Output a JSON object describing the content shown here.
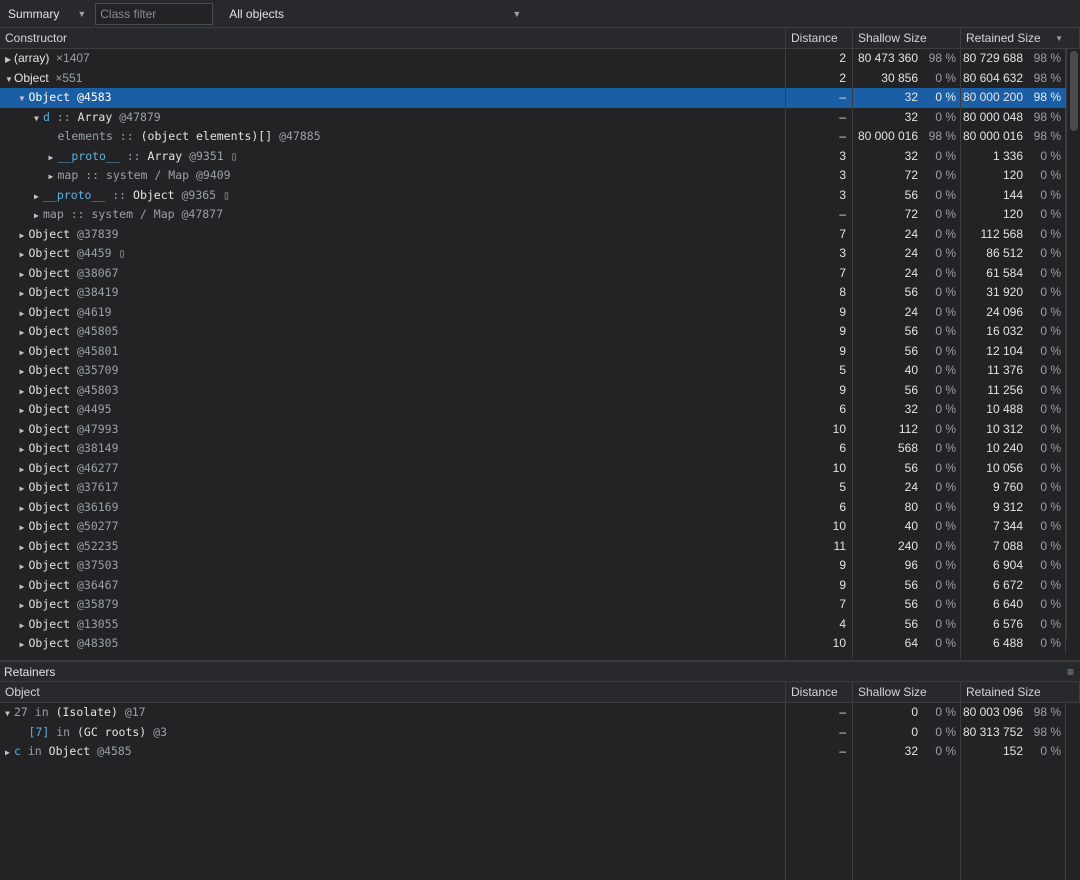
{
  "toolbar": {
    "view": "Summary",
    "filter_placeholder": "Class filter",
    "objects": "All objects"
  },
  "columns": {
    "constructor": "Constructor",
    "object": "Object",
    "distance": "Distance",
    "shallow": "Shallow Size",
    "retained": "Retained Size",
    "sort_icon": "triangle-down"
  },
  "colors": {
    "selected": "#1a5fa5",
    "property": "#5cb2dc",
    "background": "#232325"
  },
  "rows": [
    {
      "level": 0,
      "arrow": "right",
      "sans": true,
      "segs": [
        {
          "t": "(array)",
          "c": "white"
        },
        {
          "t": "  ×1407",
          "c": "gray"
        }
      ],
      "d": "2",
      "s": "80 473 360",
      "sp": "98 %",
      "r": "80 729 688",
      "rp": "98 %"
    },
    {
      "level": 0,
      "arrow": "down",
      "sans": true,
      "segs": [
        {
          "t": "Object",
          "c": "white"
        },
        {
          "t": "  ×551",
          "c": "gray"
        }
      ],
      "d": "2",
      "s": "30 856",
      "sp": "0 %",
      "r": "80 604 632",
      "rp": "98 %"
    },
    {
      "level": 1,
      "arrow": "down",
      "selected": true,
      "segs": [
        {
          "t": "Object ",
          "c": "white"
        },
        {
          "t": "@4583",
          "c": "id"
        }
      ],
      "d": "–",
      "s": "32",
      "sp": "0 %",
      "r": "80 000 200",
      "rp": "98 %"
    },
    {
      "level": 2,
      "arrow": "down",
      "segs": [
        {
          "t": "d",
          "c": "prop"
        },
        {
          "t": " :: ",
          "c": "gray"
        },
        {
          "t": "Array ",
          "c": "white"
        },
        {
          "t": "@47879",
          "c": "id"
        }
      ],
      "d": "–",
      "s": "32",
      "sp": "0 %",
      "r": "80 000 048",
      "rp": "98 %"
    },
    {
      "level": 3,
      "arrow": "",
      "segs": [
        {
          "t": "elements :: ",
          "c": "gray"
        },
        {
          "t": "(object elements)[] ",
          "c": "white"
        },
        {
          "t": "@47885",
          "c": "id"
        }
      ],
      "d": "–",
      "s": "80 000 016",
      "sp": "98 %",
      "r": "80 000 016",
      "rp": "98 %"
    },
    {
      "level": 3,
      "arrow": "right",
      "segs": [
        {
          "t": "__proto__",
          "c": "prop"
        },
        {
          "t": " :: ",
          "c": "gray"
        },
        {
          "t": "Array ",
          "c": "white"
        },
        {
          "t": "@9351 ",
          "c": "id"
        },
        {
          "t": "▯",
          "c": "gray"
        }
      ],
      "d": "3",
      "s": "32",
      "sp": "0 %",
      "r": "1 336",
      "rp": "0 %"
    },
    {
      "level": 3,
      "arrow": "right",
      "segs": [
        {
          "t": "map :: system / Map @9409",
          "c": "gray"
        }
      ],
      "d": "3",
      "s": "72",
      "sp": "0 %",
      "r": "120",
      "rp": "0 %"
    },
    {
      "level": 2,
      "arrow": "right",
      "segs": [
        {
          "t": "__proto__",
          "c": "prop"
        },
        {
          "t": " :: ",
          "c": "gray"
        },
        {
          "t": "Object ",
          "c": "white"
        },
        {
          "t": "@9365 ",
          "c": "id"
        },
        {
          "t": "▯",
          "c": "gray"
        }
      ],
      "d": "3",
      "s": "56",
      "sp": "0 %",
      "r": "144",
      "rp": "0 %"
    },
    {
      "level": 2,
      "arrow": "right",
      "segs": [
        {
          "t": "map :: system / Map @47877",
          "c": "gray"
        }
      ],
      "d": "–",
      "s": "72",
      "sp": "0 %",
      "r": "120",
      "rp": "0 %"
    },
    {
      "level": 1,
      "arrow": "right",
      "segs": [
        {
          "t": "Object ",
          "c": "white"
        },
        {
          "t": "@37839",
          "c": "id"
        }
      ],
      "d": "7",
      "s": "24",
      "sp": "0 %",
      "r": "112 568",
      "rp": "0 %"
    },
    {
      "level": 1,
      "arrow": "right",
      "segs": [
        {
          "t": "Object ",
          "c": "white"
        },
        {
          "t": "@4459 ",
          "c": "id"
        },
        {
          "t": "▯",
          "c": "gray"
        }
      ],
      "d": "3",
      "s": "24",
      "sp": "0 %",
      "r": "86 512",
      "rp": "0 %"
    },
    {
      "level": 1,
      "arrow": "right",
      "segs": [
        {
          "t": "Object ",
          "c": "white"
        },
        {
          "t": "@38067",
          "c": "id"
        }
      ],
      "d": "7",
      "s": "24",
      "sp": "0 %",
      "r": "61 584",
      "rp": "0 %"
    },
    {
      "level": 1,
      "arrow": "right",
      "segs": [
        {
          "t": "Object ",
          "c": "white"
        },
        {
          "t": "@38419",
          "c": "id"
        }
      ],
      "d": "8",
      "s": "56",
      "sp": "0 %",
      "r": "31 920",
      "rp": "0 %"
    },
    {
      "level": 1,
      "arrow": "right",
      "segs": [
        {
          "t": "Object ",
          "c": "white"
        },
        {
          "t": "@4619",
          "c": "id"
        }
      ],
      "d": "9",
      "s": "24",
      "sp": "0 %",
      "r": "24 096",
      "rp": "0 %"
    },
    {
      "level": 1,
      "arrow": "right",
      "segs": [
        {
          "t": "Object ",
          "c": "white"
        },
        {
          "t": "@45805",
          "c": "id"
        }
      ],
      "d": "9",
      "s": "56",
      "sp": "0 %",
      "r": "16 032",
      "rp": "0 %"
    },
    {
      "level": 1,
      "arrow": "right",
      "segs": [
        {
          "t": "Object ",
          "c": "white"
        },
        {
          "t": "@45801",
          "c": "id"
        }
      ],
      "d": "9",
      "s": "56",
      "sp": "0 %",
      "r": "12 104",
      "rp": "0 %"
    },
    {
      "level": 1,
      "arrow": "right",
      "segs": [
        {
          "t": "Object ",
          "c": "white"
        },
        {
          "t": "@35709",
          "c": "id"
        }
      ],
      "d": "5",
      "s": "40",
      "sp": "0 %",
      "r": "11 376",
      "rp": "0 %"
    },
    {
      "level": 1,
      "arrow": "right",
      "segs": [
        {
          "t": "Object ",
          "c": "white"
        },
        {
          "t": "@45803",
          "c": "id"
        }
      ],
      "d": "9",
      "s": "56",
      "sp": "0 %",
      "r": "11 256",
      "rp": "0 %"
    },
    {
      "level": 1,
      "arrow": "right",
      "segs": [
        {
          "t": "Object ",
          "c": "white"
        },
        {
          "t": "@4495",
          "c": "id"
        }
      ],
      "d": "6",
      "s": "32",
      "sp": "0 %",
      "r": "10 488",
      "rp": "0 %"
    },
    {
      "level": 1,
      "arrow": "right",
      "segs": [
        {
          "t": "Object ",
          "c": "white"
        },
        {
          "t": "@47993",
          "c": "id"
        }
      ],
      "d": "10",
      "s": "112",
      "sp": "0 %",
      "r": "10 312",
      "rp": "0 %"
    },
    {
      "level": 1,
      "arrow": "right",
      "segs": [
        {
          "t": "Object ",
          "c": "white"
        },
        {
          "t": "@38149",
          "c": "id"
        }
      ],
      "d": "6",
      "s": "568",
      "sp": "0 %",
      "r": "10 240",
      "rp": "0 %"
    },
    {
      "level": 1,
      "arrow": "right",
      "segs": [
        {
          "t": "Object ",
          "c": "white"
        },
        {
          "t": "@46277",
          "c": "id"
        }
      ],
      "d": "10",
      "s": "56",
      "sp": "0 %",
      "r": "10 056",
      "rp": "0 %"
    },
    {
      "level": 1,
      "arrow": "right",
      "segs": [
        {
          "t": "Object ",
          "c": "white"
        },
        {
          "t": "@37617",
          "c": "id"
        }
      ],
      "d": "5",
      "s": "24",
      "sp": "0 %",
      "r": "9 760",
      "rp": "0 %"
    },
    {
      "level": 1,
      "arrow": "right",
      "segs": [
        {
          "t": "Object ",
          "c": "white"
        },
        {
          "t": "@36169",
          "c": "id"
        }
      ],
      "d": "6",
      "s": "80",
      "sp": "0 %",
      "r": "9 312",
      "rp": "0 %"
    },
    {
      "level": 1,
      "arrow": "right",
      "segs": [
        {
          "t": "Object ",
          "c": "white"
        },
        {
          "t": "@50277",
          "c": "id"
        }
      ],
      "d": "10",
      "s": "40",
      "sp": "0 %",
      "r": "7 344",
      "rp": "0 %"
    },
    {
      "level": 1,
      "arrow": "right",
      "segs": [
        {
          "t": "Object ",
          "c": "white"
        },
        {
          "t": "@52235",
          "c": "id"
        }
      ],
      "d": "11",
      "s": "240",
      "sp": "0 %",
      "r": "7 088",
      "rp": "0 %"
    },
    {
      "level": 1,
      "arrow": "right",
      "segs": [
        {
          "t": "Object ",
          "c": "white"
        },
        {
          "t": "@37503",
          "c": "id"
        }
      ],
      "d": "9",
      "s": "96",
      "sp": "0 %",
      "r": "6 904",
      "rp": "0 %"
    },
    {
      "level": 1,
      "arrow": "right",
      "segs": [
        {
          "t": "Object ",
          "c": "white"
        },
        {
          "t": "@36467",
          "c": "id"
        }
      ],
      "d": "9",
      "s": "56",
      "sp": "0 %",
      "r": "6 672",
      "rp": "0 %"
    },
    {
      "level": 1,
      "arrow": "right",
      "segs": [
        {
          "t": "Object ",
          "c": "white"
        },
        {
          "t": "@35879",
          "c": "id"
        }
      ],
      "d": "7",
      "s": "56",
      "sp": "0 %",
      "r": "6 640",
      "rp": "0 %"
    },
    {
      "level": 1,
      "arrow": "right",
      "segs": [
        {
          "t": "Object ",
          "c": "white"
        },
        {
          "t": "@13055",
          "c": "id"
        }
      ],
      "d": "4",
      "s": "56",
      "sp": "0 %",
      "r": "6 576",
      "rp": "0 %"
    },
    {
      "level": 1,
      "arrow": "right",
      "segs": [
        {
          "t": "Object ",
          "c": "white"
        },
        {
          "t": "@48305",
          "c": "id"
        }
      ],
      "d": "10",
      "s": "64",
      "sp": "0 %",
      "r": "6 488",
      "rp": "0 %"
    }
  ],
  "retainers": {
    "title": "Retainers",
    "rows": [
      {
        "level": 0,
        "arrow": "down",
        "segs": [
          {
            "t": "27",
            "c": "gray"
          },
          {
            "t": " in ",
            "c": "gray"
          },
          {
            "t": "(Isolate) ",
            "c": "white"
          },
          {
            "t": "@17",
            "c": "id"
          }
        ],
        "d": "–",
        "s": "0",
        "sp": "0 %",
        "r": "80 003 096",
        "rp": "98 %"
      },
      {
        "level": 1,
        "arrow": "",
        "segs": [
          {
            "t": "[7]",
            "c": "prop"
          },
          {
            "t": " in ",
            "c": "gray"
          },
          {
            "t": "(GC roots) ",
            "c": "white"
          },
          {
            "t": "@3",
            "c": "id"
          }
        ],
        "d": "–",
        "s": "0",
        "sp": "0 %",
        "r": "80 313 752",
        "rp": "98 %"
      },
      {
        "level": 0,
        "arrow": "right",
        "segs": [
          {
            "t": "c",
            "c": "prop"
          },
          {
            "t": " in ",
            "c": "gray"
          },
          {
            "t": "Object ",
            "c": "white"
          },
          {
            "t": "@4585",
            "c": "id"
          }
        ],
        "d": "–",
        "s": "32",
        "sp": "0 %",
        "r": "152",
        "rp": "0 %"
      }
    ]
  }
}
